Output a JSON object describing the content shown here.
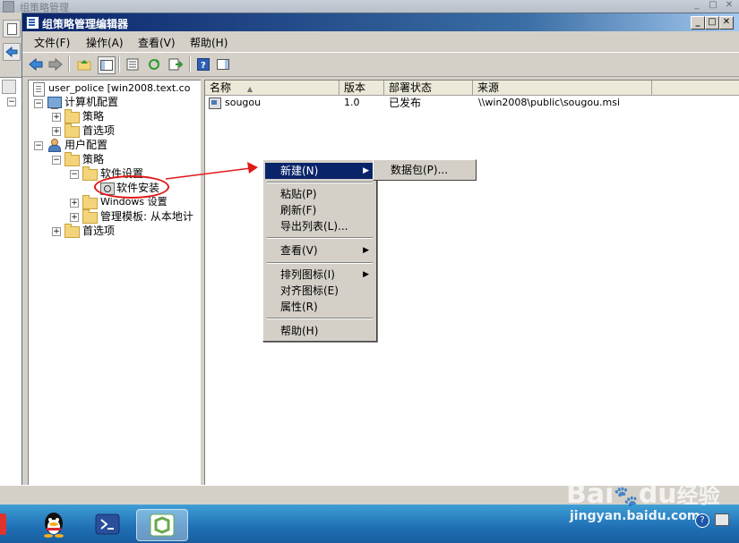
{
  "background_window": {
    "title": "组策略管理"
  },
  "window": {
    "title": "组策略管理编辑器",
    "controls": {
      "minimize": "_",
      "maximize": "□",
      "close": "✕"
    }
  },
  "outer_controls": {
    "minimize": "_",
    "maximize": "□",
    "close": "✕"
  },
  "menubar": [
    "文件(F)",
    "操作(A)",
    "查看(V)",
    "帮助(H)"
  ],
  "tree": {
    "root": "user_police [win2008.text.co",
    "computer_config": "计算机配置",
    "policy": "策略",
    "preferences": "首选项",
    "user_config": "用户配置",
    "user_policy": "策略",
    "software_settings": "软件设置",
    "software_install": "软件安装",
    "windows_settings": "Windows 设置",
    "admin_templates": "管理模板: 从本地计",
    "user_preferences": "首选项",
    "expander_plus": "+",
    "expander_minus": "−"
  },
  "list": {
    "columns": [
      "名称",
      "版本",
      "部署状态",
      "来源"
    ],
    "sort_indicator": "▲",
    "rows": [
      {
        "name": "sougou",
        "version": "1.0",
        "status": "已发布",
        "source": "\\\\win2008\\public\\sougou.msi"
      }
    ]
  },
  "context_menu": {
    "items": [
      "新建(N)",
      "粘贴(P)",
      "刷新(F)",
      "导出列表(L)...",
      "查看(V)",
      "排列图标(I)",
      "对齐图标(E)",
      "属性(R)",
      "帮助(H)"
    ],
    "submenu_arrow": "▶",
    "submenu": [
      "数据包(P)..."
    ]
  },
  "watermark": {
    "brand": "Bai",
    "brand2": "du",
    "brand_cn": "经验",
    "url": "jingyan.baidu.com"
  },
  "colors": {
    "selection": "#0a246a",
    "annotation": "#e21818",
    "taskbar": "#1f6fb4"
  }
}
